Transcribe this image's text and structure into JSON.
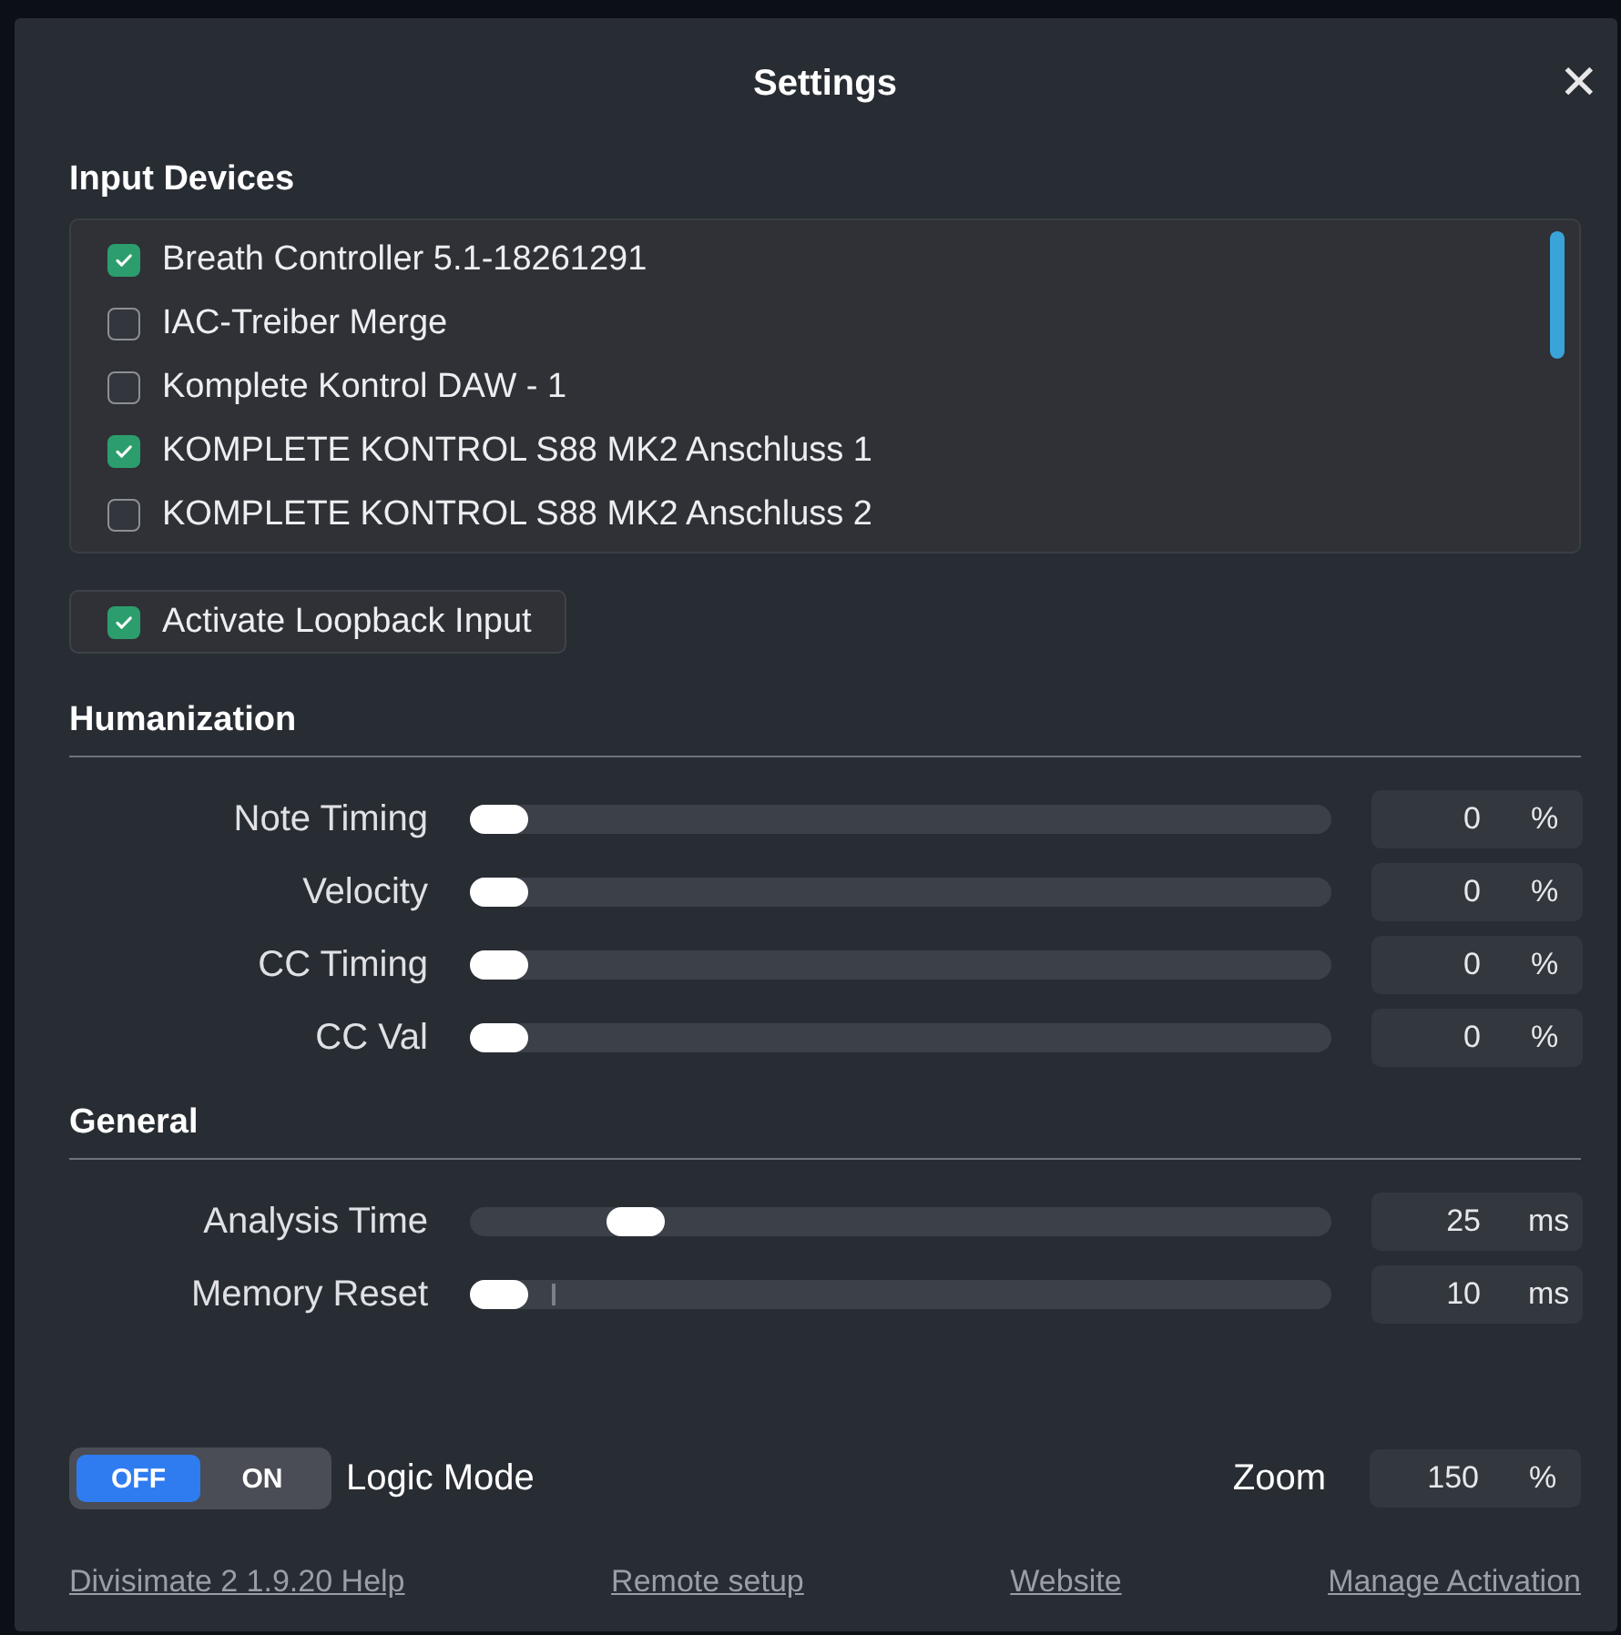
{
  "window": {
    "title": "Settings",
    "close": "✕"
  },
  "input_devices": {
    "heading": "Input Devices",
    "items": [
      {
        "label": "Breath Controller 5.1-18261291",
        "checked": true
      },
      {
        "label": "IAC-Treiber Merge",
        "checked": false
      },
      {
        "label": "Komplete Kontrol DAW - 1",
        "checked": false
      },
      {
        "label": "KOMPLETE KONTROL S88 MK2 Anschluss 1",
        "checked": true
      },
      {
        "label": "KOMPLETE KONTROL S88 MK2 Anschluss 2",
        "checked": false
      }
    ]
  },
  "loopback": {
    "label": "Activate Loopback Input",
    "checked": true
  },
  "humanization": {
    "heading": "Humanization",
    "sliders": [
      {
        "label": "Note Timing",
        "level": 0,
        "value": "0",
        "unit": "%"
      },
      {
        "label": "Velocity",
        "level": 0,
        "value": "0",
        "unit": "%"
      },
      {
        "label": "CC Timing",
        "level": 0,
        "value": "0",
        "unit": "%"
      },
      {
        "label": "CC Val",
        "level": 0,
        "value": "0",
        "unit": "%"
      }
    ]
  },
  "general": {
    "heading": "General",
    "sliders": [
      {
        "label": "Analysis Time",
        "level": 0.17,
        "value": "25",
        "unit": "ms"
      },
      {
        "label": "Memory Reset",
        "level": 0,
        "value": "10",
        "unit": "ms",
        "tick": true
      }
    ]
  },
  "logic_mode": {
    "label": "Logic Mode",
    "options": [
      {
        "label": "OFF",
        "selected": true
      },
      {
        "label": "ON",
        "selected": false
      }
    ]
  },
  "zoom": {
    "label": "Zoom",
    "value": "150",
    "unit": "%"
  },
  "footer_links": [
    "Divisimate 2 1.9.20 Help",
    "Remote setup",
    "Website",
    "Manage Activation"
  ]
}
